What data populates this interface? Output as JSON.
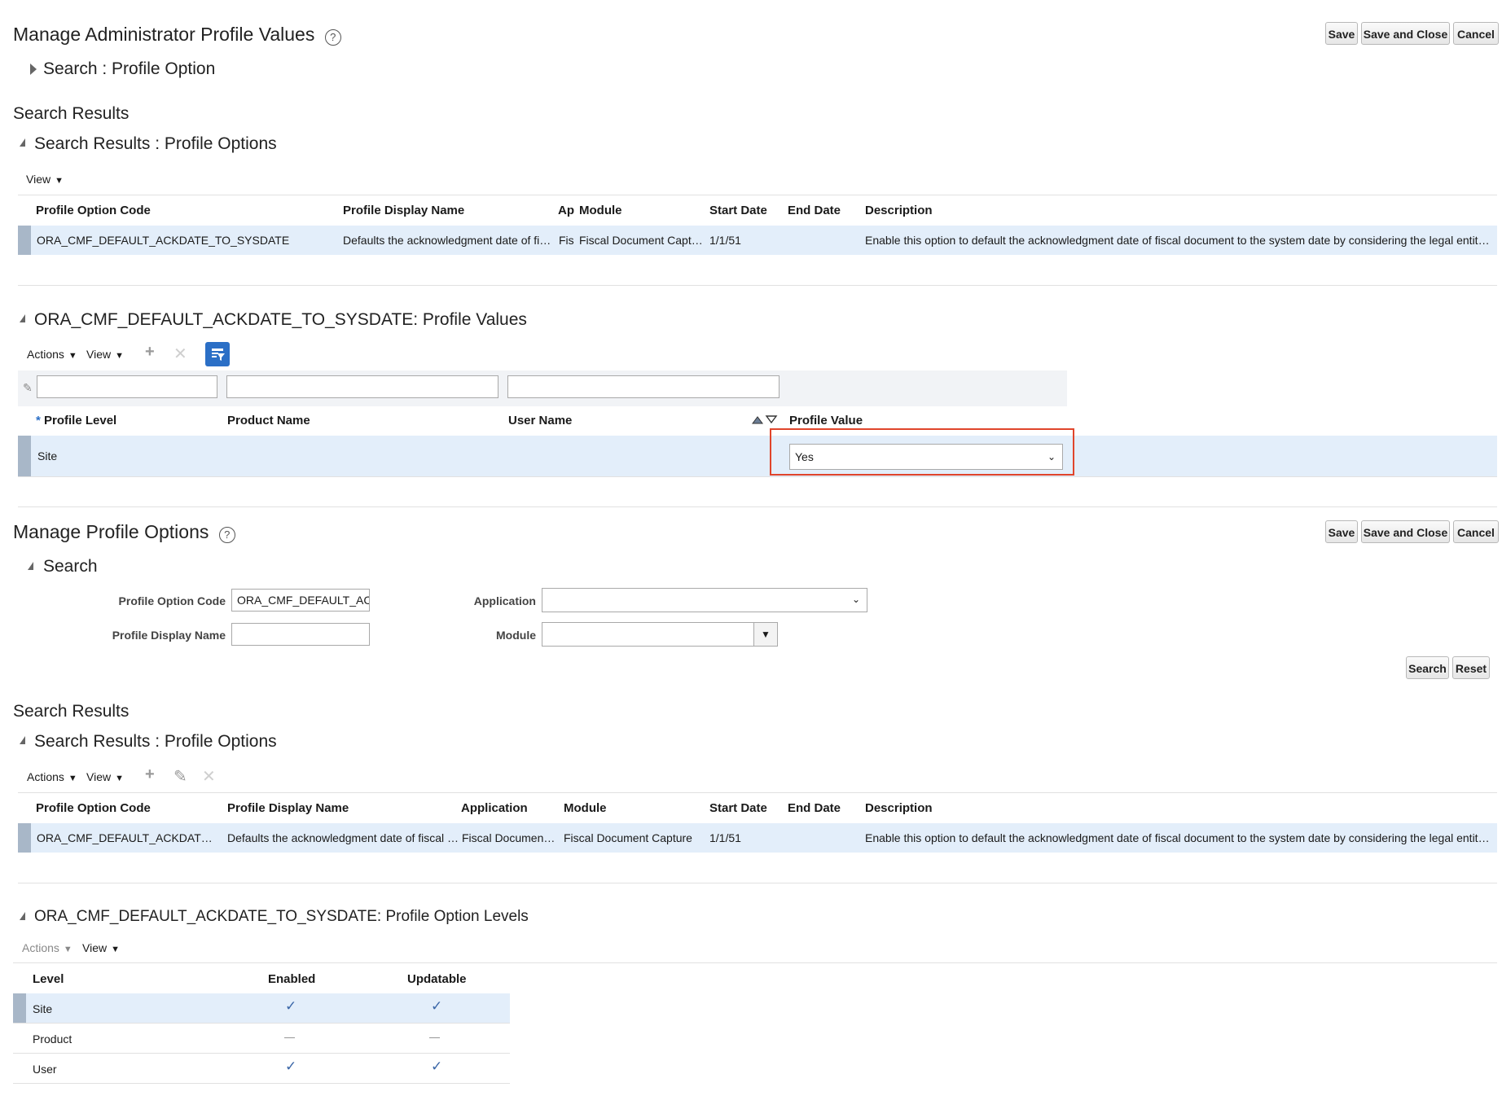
{
  "top": {
    "title": "Manage Administrator Profile Values",
    "search_label": "Search : Profile Option",
    "buttons": {
      "save": "Save",
      "save_close": "Save and Close",
      "cancel": "Cancel"
    },
    "results_heading": "Search Results",
    "results_sub": "Search Results : Profile Options",
    "view": "View",
    "columns": [
      "Profile Option Code",
      "Profile Display Name",
      "Ap",
      "Module",
      "Start Date",
      "End Date",
      "Description"
    ],
    "row": {
      "code": "ORA_CMF_DEFAULT_ACKDATE_TO_SYSDATE",
      "display": "Defaults the acknowledgment date of fi…",
      "app": "Fis",
      "module": "Fiscal Document Capt…",
      "start": "1/1/51",
      "end": "",
      "description": "Enable this option to default the acknowledgment date of fiscal document to the system date by considering the legal entity ti…"
    }
  },
  "values": {
    "heading": "ORA_CMF_DEFAULT_ACKDATE_TO_SYSDATE: Profile Values",
    "actions": "Actions",
    "view": "View",
    "columns": [
      "Profile Level",
      "Product Name",
      "User Name",
      "Profile Value"
    ],
    "required_marker": "*",
    "row": {
      "level": "Site",
      "product": "",
      "user": "",
      "value": "Yes"
    }
  },
  "manage": {
    "title": "Manage Profile Options",
    "buttons": {
      "save": "Save",
      "save_close": "Save and Close",
      "cancel": "Cancel"
    },
    "search_heading": "Search",
    "fields": {
      "code_label": "Profile Option Code",
      "code_value": "ORA_CMF_DEFAULT_ACK",
      "display_label": "Profile Display Name",
      "display_value": "",
      "application_label": "Application",
      "application_value": "",
      "module_label": "Module",
      "module_value": ""
    },
    "search_btn": "Search",
    "reset_btn": "Reset",
    "results_heading": "Search Results",
    "results_sub": "Search Results : Profile Options",
    "actions": "Actions",
    "view": "View",
    "columns": [
      "Profile Option Code",
      "Profile Display Name",
      "Application",
      "Module",
      "Start Date",
      "End Date",
      "Description"
    ],
    "row": {
      "code": "ORA_CMF_DEFAULT_ACKDATE_T…",
      "display": "Defaults the acknowledgment date of fiscal …",
      "app": "Fiscal Documen…",
      "module": "Fiscal Document Capture",
      "start": "1/1/51",
      "end": "",
      "description": "Enable this option to default the acknowledgment date of fiscal document to the system date by considering the legal entity ti…"
    }
  },
  "levels": {
    "heading": "ORA_CMF_DEFAULT_ACKDATE_TO_SYSDATE: Profile Option Levels",
    "actions": "Actions",
    "view": "View",
    "columns": [
      "Level",
      "Enabled",
      "Updatable"
    ],
    "rows": [
      {
        "level": "Site",
        "enabled": true,
        "updatable": true
      },
      {
        "level": "Product",
        "enabled": false,
        "updatable": false
      },
      {
        "level": "User",
        "enabled": true,
        "updatable": true
      }
    ]
  },
  "icons": {
    "help": "help-circle-icon",
    "add": "plus-icon",
    "delete": "x-icon",
    "edit": "pencil-icon",
    "query": "query-by-example-icon",
    "sort": "sort-asc-desc-icon",
    "check": "checkmark-icon"
  },
  "colors": {
    "selected_row": "#e3eefa",
    "highlight_box": "#e0452b",
    "query_button": "#2b6fc6"
  }
}
